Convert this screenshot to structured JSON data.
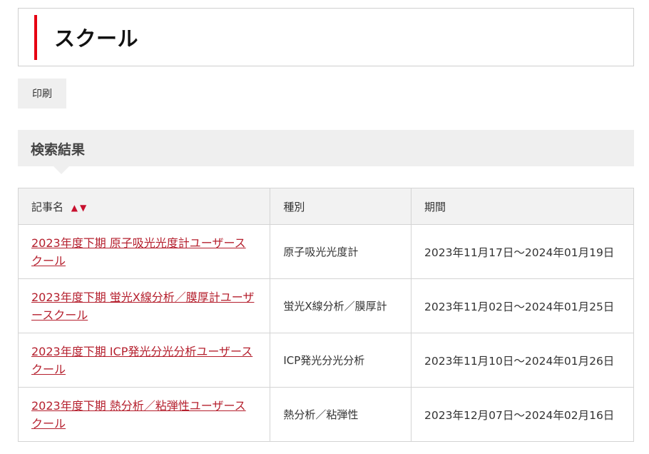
{
  "page": {
    "title": "スクール",
    "print_label": "印刷",
    "section_title": "検索結果"
  },
  "table": {
    "headers": {
      "name": "記事名",
      "sort_asc": "▲",
      "sort_desc": "▼",
      "type": "種別",
      "period": "期間"
    },
    "rows": [
      {
        "name": "2023年度下期 原子吸光光度計ユーザースクール",
        "type": "原子吸光光度計",
        "period": "2023年11月17日～2024年01月19日"
      },
      {
        "name": "2023年度下期 蛍光X線分析／膜厚計ユーザースクール",
        "type": "蛍光X線分析／膜厚計",
        "period": "2023年11月02日～2024年01月25日"
      },
      {
        "name": "2023年度下期 ICP発光分光分析ユーザースクール",
        "type": "ICP発光分光分析",
        "period": "2023年11月10日～2024年01月26日"
      },
      {
        "name": "2023年度下期 熱分析／粘弾性ユーザースクール",
        "type": "熱分析／粘弾性",
        "period": "2023年12月07日～2024年02月16日"
      }
    ]
  },
  "colors": {
    "accent_red": "#e60012",
    "link": "#b5202e",
    "header_bg": "#efefef"
  }
}
